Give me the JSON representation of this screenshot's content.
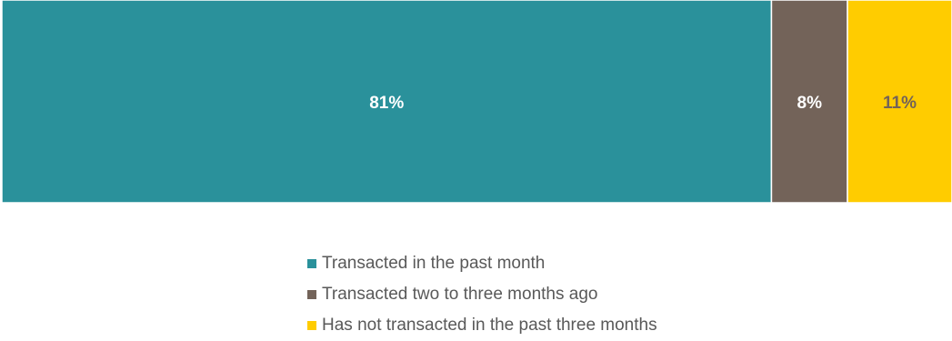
{
  "chart_data": {
    "type": "bar",
    "orientation": "horizontal-stacked-100",
    "series": [
      {
        "name": "Transacted in the past month",
        "values": [
          81
        ],
        "label": "81%",
        "color": "#2A919B",
        "label_color": "#ffffff"
      },
      {
        "name": "Transacted two to three months ago",
        "values": [
          8
        ],
        "label": "8%",
        "color": "#736359",
        "label_color": "#ffffff"
      },
      {
        "name": "Has not transacted in the past three months",
        "values": [
          11
        ],
        "label": "11%",
        "color": "#FFCC00",
        "label_color": "#736359"
      }
    ],
    "xlim": [
      0,
      100
    ],
    "legend_position": "bottom-center",
    "grid": false
  }
}
